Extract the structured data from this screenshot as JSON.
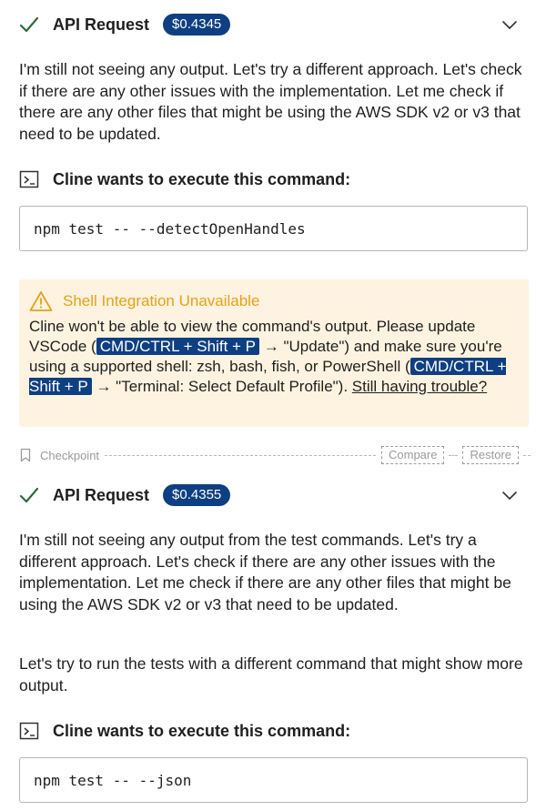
{
  "requests": [
    {
      "title": "API Request",
      "cost": "$0.4345",
      "paragraphs": [
        "I'm still not seeing any output. Let's try a different approach. Let's check if there are any other issues with the implementation. Let me check if there are any other files that might be using the AWS SDK v2 or v3 that need to be updated."
      ],
      "command_header": "Cline wants to execute this command:",
      "command": "npm test -- --detectOpenHandles"
    },
    {
      "title": "API Request",
      "cost": "$0.4355",
      "paragraphs": [
        "I'm still not seeing any output from the test commands. Let's try a different approach. Let's check if there are any other issues with the implementation. Let me check if there are any other files that might be using the AWS SDK v2 or v3 that need to be updated.",
        "Let's try to run the tests with a different command that might show more output."
      ],
      "command_header": "Cline wants to execute this command:",
      "command": "npm test -- --json"
    }
  ],
  "warning": {
    "title": "Shell Integration Unavailable",
    "text_1": "Cline won't be able to view the command's output. Please update VSCode (",
    "kbd_1": "CMD/CTRL + Shift + P",
    "text_2": " → \"Update\") and make sure you're using a supported shell: zsh, bash, fish, or PowerShell (",
    "kbd_2": "CMD/CTRL + Shift + P",
    "text_3": " → \"Terminal: Select Default Profile\"). ",
    "link": "Still having trouble?"
  },
  "checkpoint": {
    "label": "Checkpoint",
    "compare": "Compare",
    "restore": "Restore"
  },
  "icons": {
    "check": "check-icon",
    "chevron": "chevron-down-icon",
    "terminal": "terminal-icon",
    "warning": "warning-icon",
    "bookmark": "bookmark-icon"
  },
  "colors": {
    "badge": "#0e3f83",
    "warning_bg": "#fdf3e0",
    "warning_title": "#e6a11a",
    "check": "#2e6b3c"
  }
}
